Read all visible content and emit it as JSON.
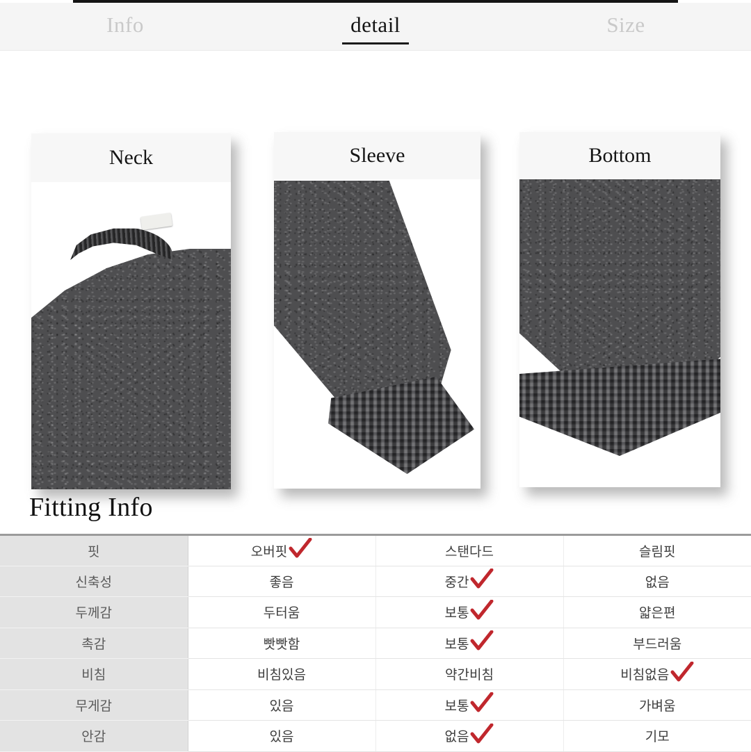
{
  "page": {
    "background": "#ffffff",
    "accent_check_color": "#c0272d",
    "tabbar_background": "#f5f5f5",
    "top_rule_color": "#141414"
  },
  "tabs": [
    {
      "label": "Info",
      "active": false
    },
    {
      "label": "detail",
      "active": true
    },
    {
      "label": "Size",
      "active": false
    }
  ],
  "detail_cards": [
    {
      "label": "Neck",
      "photo": "sweater-neckline-close-up"
    },
    {
      "label": "Sleeve",
      "photo": "sweater-sleeve-cuff-close-up"
    },
    {
      "label": "Bottom",
      "photo": "sweater-bottom-hem-close-up"
    }
  ],
  "fitting_info": {
    "heading": "Fitting Info",
    "rows": [
      {
        "label": "핏",
        "options": [
          {
            "text": "오버핏",
            "checked": true
          },
          {
            "text": "스탠다드",
            "checked": false
          },
          {
            "text": "슬림핏",
            "checked": false
          }
        ]
      },
      {
        "label": "신축성",
        "options": [
          {
            "text": "좋음",
            "checked": false
          },
          {
            "text": "중간",
            "checked": true
          },
          {
            "text": "없음",
            "checked": false
          }
        ]
      },
      {
        "label": "두께감",
        "options": [
          {
            "text": "두터움",
            "checked": false
          },
          {
            "text": "보통",
            "checked": true
          },
          {
            "text": "얇은편",
            "checked": false
          }
        ]
      },
      {
        "label": "촉감",
        "options": [
          {
            "text": "빳빳함",
            "checked": false
          },
          {
            "text": "보통",
            "checked": true
          },
          {
            "text": "부드러움",
            "checked": false
          }
        ]
      },
      {
        "label": "비침",
        "options": [
          {
            "text": "비침있음",
            "checked": false
          },
          {
            "text": "약간비침",
            "checked": false
          },
          {
            "text": "비침없음",
            "checked": true
          }
        ]
      },
      {
        "label": "무게감",
        "options": [
          {
            "text": "있음",
            "checked": false
          },
          {
            "text": "보통",
            "checked": true
          },
          {
            "text": "가벼움",
            "checked": false
          }
        ]
      },
      {
        "label": "안감",
        "options": [
          {
            "text": "있음",
            "checked": false
          },
          {
            "text": "없음",
            "checked": true
          },
          {
            "text": "기모",
            "checked": false
          }
        ]
      }
    ]
  }
}
